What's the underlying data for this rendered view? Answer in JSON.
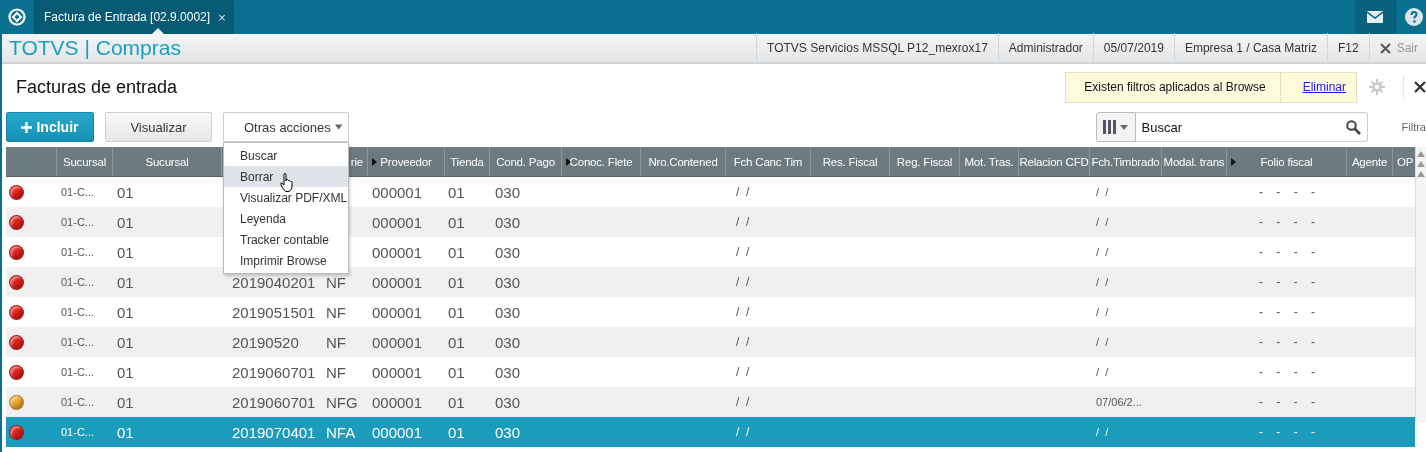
{
  "top_bar": {
    "tab": {
      "title": "Factura de Entrada [02.9.0002]",
      "close": "×"
    }
  },
  "header": {
    "brand": "TOTVS | Compras",
    "info": [
      "TOTVS Servicios MSSQL P12_mexrox17",
      "Administrador",
      "05/07/2019",
      "Empresa 1 / Casa Matriz",
      "F12"
    ],
    "exit": "Sair"
  },
  "page": {
    "title": "Facturas de entrada",
    "filter_notice": {
      "text": "Existen filtros aplicados al Browse",
      "link": "Eliminar"
    }
  },
  "toolbar": {
    "buttons": [
      {
        "label": "Incluir",
        "kind": "primary"
      },
      {
        "label": "Visualizar",
        "kind": "secondary"
      },
      {
        "label": "Otras acciones",
        "kind": "dropdown"
      }
    ],
    "search": {
      "value": "Buscar"
    },
    "filter_label": "Filtra"
  },
  "menu": {
    "items": [
      {
        "label": "Buscar",
        "selected": false
      },
      {
        "label": "Borrar",
        "selected": true
      },
      {
        "label": "Visualizar PDF/XML",
        "selected": false
      },
      {
        "label": "Leyenda",
        "selected": false
      },
      {
        "label": "Tracker contable",
        "selected": false
      },
      {
        "label": "Imprimir Browse",
        "selected": false
      }
    ]
  },
  "table": {
    "columns": [
      {
        "marker": false
      },
      {
        "label": "Sucursal",
        "marker": false
      },
      {
        "label": "Sucursal",
        "marker": false
      },
      {},
      {
        "label": "rie"
      },
      {
        "label": "Proveedor",
        "marker": true
      },
      {
        "label": "Tienda",
        "marker": false
      },
      {
        "label": "Cond. Pago",
        "marker": false
      },
      {
        "label": "Conoc. Flete",
        "marker": true
      },
      {
        "label": "Nro.Contened",
        "marker": false
      },
      {
        "label": "Fch Canc Tim",
        "marker": false
      },
      {
        "label": "Res. Fiscal",
        "marker": false
      },
      {
        "label": "Reg. Fiscal",
        "marker": false
      },
      {
        "label": "Mot. Tras.",
        "marker": false
      },
      {
        "label": "Relacion CFD",
        "marker": false
      },
      {
        "label": "Fch.Timbrado",
        "marker": false
      },
      {
        "label": "Modal. trans",
        "marker": false
      },
      {
        "label": "Folio fiscal",
        "marker": true
      },
      {
        "label": "Agente",
        "marker": false
      },
      {
        "label": "OP",
        "marker": false
      }
    ],
    "rows": [
      {
        "color": "#e0201c",
        "selected": false,
        "branch_code": "01-C...",
        "branch": "01",
        "supplier": "000001",
        "store": "01",
        "payment_terms": "030",
        "cancel_date": "/  /",
        "stamp_date": "/  /",
        "fiscal_folio": "-    -    -    -"
      },
      {
        "color": "#e0201c",
        "selected": false,
        "branch_code": "01-C...",
        "branch": "01",
        "supplier": "000001",
        "store": "01",
        "payment_terms": "030",
        "cancel_date": "/  /",
        "stamp_date": "/  /",
        "fiscal_folio": "-    -    -    -"
      },
      {
        "color": "#e0201c",
        "selected": false,
        "branch_code": "01-C...",
        "branch": "01",
        "supplier": "000001",
        "store": "01",
        "payment_terms": "030",
        "cancel_date": "/  /",
        "stamp_date": "/  /",
        "fiscal_folio": "-    -    -    -"
      },
      {
        "color": "#e0201c",
        "selected": false,
        "branch_code": "01-C...",
        "branch": "01",
        "document": "2019040201",
        "series": "NF",
        "supplier": "000001",
        "store": "01",
        "payment_terms": "030",
        "cancel_date": "/  /",
        "stamp_date": "/  /",
        "fiscal_folio": "-    -    -    -"
      },
      {
        "color": "#e0201c",
        "selected": false,
        "branch_code": "01-C...",
        "branch": "01",
        "document": "2019051501",
        "series": "NF",
        "supplier": "000001",
        "store": "01",
        "payment_terms": "030",
        "cancel_date": "/  /",
        "stamp_date": "/  /",
        "fiscal_folio": "-    -    -    -"
      },
      {
        "color": "#e0201c",
        "selected": false,
        "branch_code": "01-C...",
        "branch": "01",
        "document": "20190520",
        "series": "NF",
        "supplier": "000001",
        "store": "01",
        "payment_terms": "030",
        "cancel_date": "/  /",
        "stamp_date": "/  /",
        "fiscal_folio": "-    -    -    -"
      },
      {
        "color": "#e0201c",
        "selected": false,
        "branch_code": "01-C...",
        "branch": "01",
        "document": "2019060701",
        "series": "NF",
        "supplier": "000001",
        "store": "01",
        "payment_terms": "030",
        "cancel_date": "/  /",
        "stamp_date": "/  /",
        "fiscal_folio": "-    -    -    -"
      },
      {
        "color": "#f0a830",
        "selected": false,
        "branch_code": "01-C...",
        "branch": "01",
        "document": "2019060701",
        "series": "NFG",
        "supplier": "000001",
        "store": "01",
        "payment_terms": "030",
        "cancel_date": "/  /",
        "stamp_date": "07/06/2...",
        "fiscal_folio": "-    -    -    -"
      },
      {
        "color": "#e0201c",
        "selected": true,
        "branch_code": "01-C...",
        "branch": "01",
        "document": "2019070401",
        "series": "NFA",
        "supplier": "000001",
        "store": "01",
        "payment_terms": "030",
        "cancel_date": "/  /",
        "stamp_date": "/  /",
        "fiscal_folio": "-    -    -    -"
      }
    ]
  }
}
